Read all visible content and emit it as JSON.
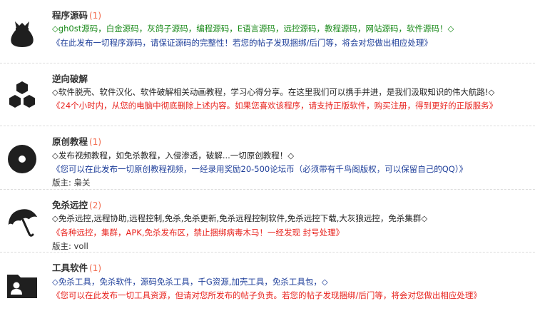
{
  "forums": [
    {
      "title": "程序源码",
      "count": "(1)",
      "icon": "money-bag-icon",
      "desc": "◇gh0st源码，白金源码，灰鸽子源码，编程源码，E语言源码，远控源码，教程源码，网站源码，软件源码！◇",
      "desc_color": "green",
      "notice": "《在此发布一切程序源码，请保证源码的完整性！若您的帖子发现捆绑/后门等，将会对您做出相应处理》",
      "notice_color": "blue",
      "moderator": ""
    },
    {
      "title": "逆向破解",
      "count": "",
      "icon": "hexagons-icon",
      "desc": "◇软件脱壳、软件汉化、软件破解相关动画教程，学习心得分享。在这里我们可以携手并进，是我们汲取知识的伟大航路!◇",
      "desc_color": "dark",
      "notice": "《24个小时内，从您的电脑中彻底删除上述内容。如果您喜欢该程序，请支持正版软件，购买注册，得到更好的正版服务》",
      "notice_color": "red",
      "moderator": ""
    },
    {
      "title": "原创教程",
      "count": "(1)",
      "icon": "disc-icon",
      "desc": "◇发布视频教程，如免杀教程，入侵渗透，破解...一切原创教程！◇",
      "desc_color": "dark",
      "notice": "《您可以在此发布一切原创教程视频，一经录用奖励20-500论坛币（必须带有千鸟阁版权，可以保留自己的QQ）》",
      "notice_color": "blue",
      "moderator": "版主: 枭关"
    },
    {
      "title": "免杀远控",
      "count": "(2)",
      "icon": "umbrella-icon",
      "desc": "◇免杀远控,远程协助,远程控制,免杀,免杀更新,免杀远程控制软件,免杀远控下载,大灰狼远控，免杀集群◇",
      "desc_color": "dark",
      "notice": "《各种远控，集群，APK,免杀发布区，禁止捆绑病毒木马！一经发现 封号处理》",
      "notice_color": "red",
      "moderator": "版主: voll"
    },
    {
      "title": "工具软件",
      "count": "(1)",
      "icon": "user-folder-icon",
      "desc": "◇免杀工具，免杀软件，源码免杀工具，千G资源,加壳工具，免杀工具包，◇",
      "desc_color": "blue",
      "notice": "《您可以在此发布一切工具资源，但请对您所发布的帖子负责。若您的帖子发现捆绑/后门等，将会对您做出相应处理》",
      "notice_color": "red",
      "moderator": ""
    }
  ]
}
